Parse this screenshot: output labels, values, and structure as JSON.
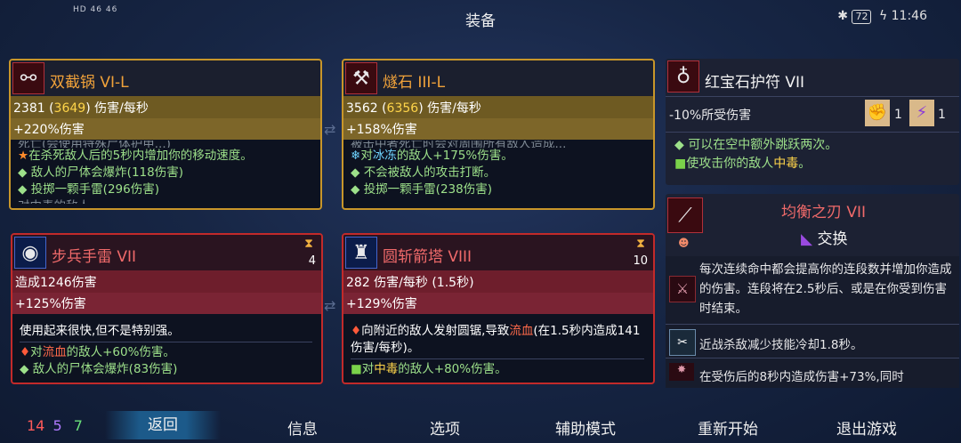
{
  "status": {
    "left": "HD 46 46",
    "title": "装备",
    "battery": "72",
    "time": "11:46"
  },
  "weapon1": {
    "name": "双截锅  VI-L",
    "dps_base": "2381 (",
    "dps_hl": "3649",
    "dps_unit": ") 伤害/每秒",
    "bonus": "+220%伤害",
    "line0": "死亡(会使用特殊尸体护甲...)",
    "line1": "在杀死敌人后的5秒内增加你的移动速度。",
    "line2": "敌人的尸体会爆炸(118伤害)",
    "line3": "投掷一颗手雷(296伤害)",
    "line4": "对中毒的敌人..."
  },
  "weapon2": {
    "name": "燧石  III-L",
    "dps_base": "3562 (",
    "dps_hl": "6356",
    "dps_unit": ") 伤害/每秒",
    "bonus": "+158%伤害",
    "line0": "被击中者死亡时会对周围所有敌人造成...",
    "line1_pre": "对",
    "line1_hl": "冰冻",
    "line1_post": "的敌人+175%伤害。",
    "line2": "不会被敌人的攻击打断。",
    "line3": "投掷一颗手雷(238伤害)"
  },
  "skill1": {
    "name": "步兵手雷  VII",
    "cooldown": "4",
    "stat1": "造成1246伤害",
    "bonus": "+125%伤害",
    "desc": "使用起来很快,但不是特别强。",
    "line1_pre": "对",
    "line1_hl": "流血",
    "line1_post": "的敌人+60%伤害。",
    "line2": "敌人的尸体会爆炸(83伤害)"
  },
  "skill2": {
    "name": "圆斩箭塔  VIII",
    "cooldown": "10",
    "stat1": "282 伤害/每秒 (1.5秒)",
    "bonus": "+129%伤害",
    "desc_pre": "向附近的敌人发射圆锯,导致",
    "desc_hl": "流血",
    "desc_post": "(在1.5秒内造成141伤害/每秒)。",
    "line1_pre": "对",
    "line1_hl": "中毒",
    "line1_post": "的敌人+80%伤害。"
  },
  "amulet": {
    "name": "红宝石护符  VII",
    "effect": "-10%所受伤害",
    "count1": "1",
    "count2": "1",
    "line1": "可以在空中额外跳跃两次。",
    "line2_pre": "使攻击你的敌人",
    "line2_hl": "中毒",
    "line2_post": "。"
  },
  "mutation": {
    "name": "均衡之刃  VII",
    "swap": "交换",
    "p1": "每次连续命中都会提高你的连段数并增加你造成的伤害。连段将在2.5秒后、或是在你受到伤害时结束。",
    "p2": "近战杀敌减少技能冷却1.8秒。",
    "p3": "在受伤后的8秒内造成伤害+73%,同时"
  },
  "footer": {
    "scroll_red": "14",
    "scroll_purple": "5",
    "scroll_green": "7",
    "back": "返回",
    "info": "信息",
    "options": "选项",
    "assist": "辅助模式",
    "restart": "重新开始",
    "quit": "退出游戏"
  },
  "colors": {
    "gold_border": "#c8962a",
    "red_border": "#c22a2a",
    "green_text": "#9de08a",
    "highlight": "#ffd54a"
  }
}
